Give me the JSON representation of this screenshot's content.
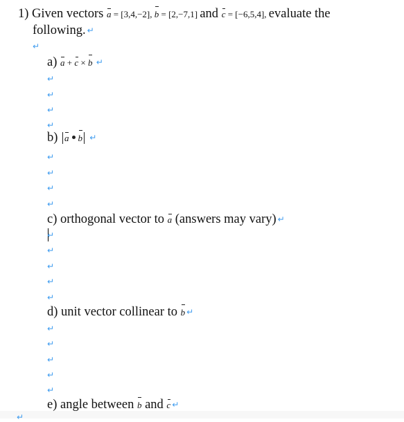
{
  "document": {
    "question": {
      "number": "1)",
      "intro": "Given vectors",
      "vectors": [
        {
          "name": "a",
          "value": "= [3,4,−2],"
        },
        {
          "name": "b",
          "value": "= [2,−7,1]"
        },
        {
          "name": "c",
          "value": "= [−6,5,4],"
        }
      ],
      "and_word": "and",
      "tail": "evaluate the",
      "line2": "following."
    },
    "parts": [
      {
        "label": "a)",
        "expr": {
          "v1": "a",
          "op1": "+",
          "v2": "c",
          "op2": "×",
          "v3": "b"
        }
      },
      {
        "label": "b)",
        "expr": {
          "v1": "a",
          "v2": "b"
        }
      },
      {
        "label": "c)",
        "text_before": "orthogonal vector to",
        "vec": "a",
        "text_after": "(answers may vary)"
      },
      {
        "label": "d)",
        "text_before": "unit vector collinear to",
        "vec": "b"
      },
      {
        "label": "e)",
        "text_before": "angle between",
        "vec1": "b",
        "and_word": "and",
        "vec2": "c"
      }
    ],
    "paragraph_mark": "↵"
  },
  "colors": {
    "paragraph_mark": "#3d9bef",
    "text": "#111111"
  }
}
